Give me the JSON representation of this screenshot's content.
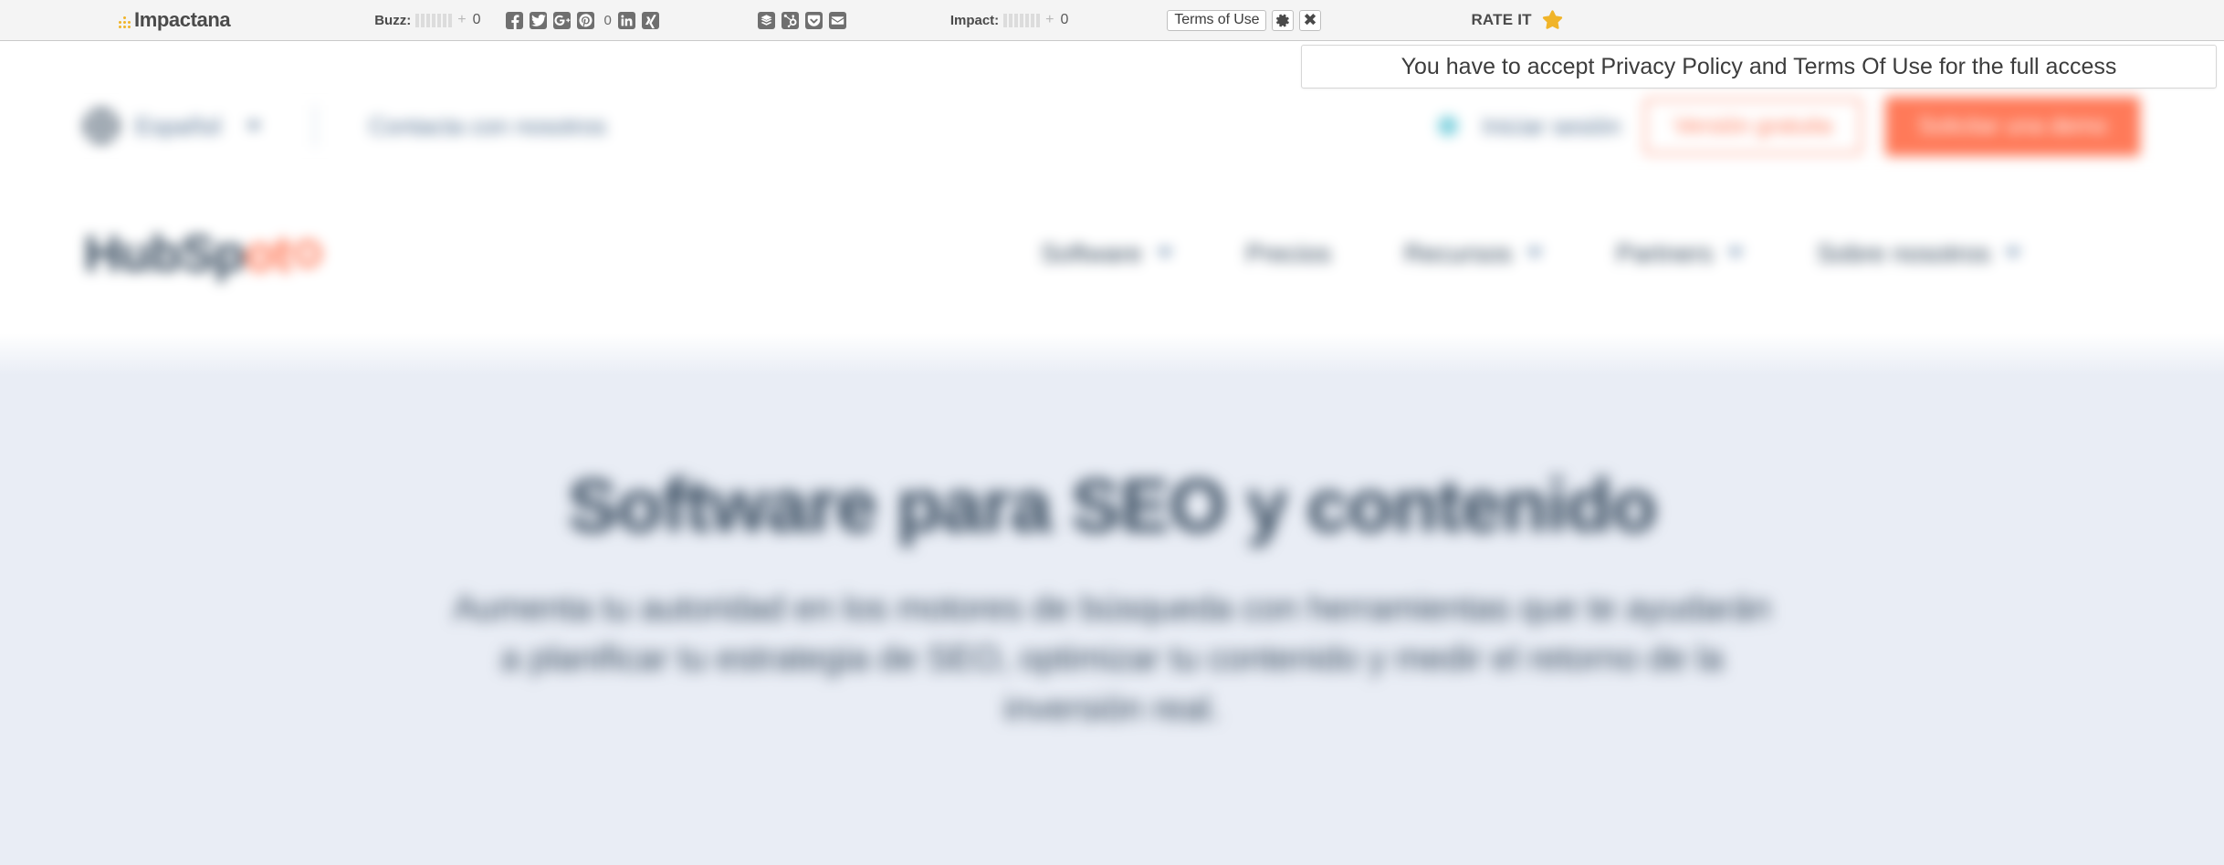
{
  "toolbar": {
    "brand": "Impactana",
    "buzz": {
      "label": "Buzz:",
      "plus": "+",
      "value": "0",
      "bars": 7
    },
    "impact": {
      "label": "Impact:",
      "plus": "+",
      "value": "0",
      "bars": 7
    },
    "share_icons": [
      {
        "name": "facebook-icon",
        "title": "Facebook",
        "count": ""
      },
      {
        "name": "twitter-icon",
        "title": "Twitter",
        "count": ""
      },
      {
        "name": "google-plus-icon",
        "title": "Google Plus",
        "count": ""
      },
      {
        "name": "pinterest-icon",
        "title": "Pinterest",
        "count": "0"
      },
      {
        "name": "linkedin-icon",
        "title": "LinkedIn",
        "count": ""
      },
      {
        "name": "xing-icon",
        "title": "XING",
        "count": ""
      }
    ],
    "content_icons": [
      {
        "name": "buffer-icon",
        "title": "Buffer"
      },
      {
        "name": "hubspot-icon",
        "title": "HubSpot"
      },
      {
        "name": "pocket-icon",
        "title": "Pocket"
      },
      {
        "name": "email-icon",
        "title": "Email"
      }
    ],
    "terms_button": "Terms of Use",
    "settings_icon": "gear-icon",
    "close_icon": "close-icon",
    "rate_it_label": "RATE IT",
    "rate_it_icon": "star-icon",
    "colors": {
      "bar_background": "#f4f4f4",
      "bar_border": "#c9c9c9",
      "brand_accent": "#f0b429",
      "icon_fill": "#6f6f6f",
      "star": "#f0b429"
    }
  },
  "banner": {
    "message": "You have to accept Privacy Policy and Terms Of Use for the full access"
  },
  "site": {
    "utility_bar": {
      "language": "Español",
      "language_icon": "globe-icon",
      "contact_link": "Contacta con nosotros",
      "right_links": [
        "Iniciar sesión"
      ],
      "secondary_button": "Versión gratuita",
      "primary_button": "Solicitar una demo"
    },
    "logo": {
      "text_dark": "HubSp",
      "text_orange": "ot"
    },
    "nav_items": [
      {
        "label": "Software",
        "has_caret": true
      },
      {
        "label": "Precios",
        "has_caret": false
      },
      {
        "label": "Recursos",
        "has_caret": true
      },
      {
        "label": "Partners",
        "has_caret": true
      },
      {
        "label": "Sobre nosotros",
        "has_caret": true
      }
    ],
    "hero": {
      "title": "Software para SEO y contenido",
      "subtitle": "Aumenta tu autoridad en los motores de búsqueda con herramientas que te ayudarán a planificar tu estrategia de SEO, optimizar tu contenido y medir el retorno de la inversión real."
    },
    "colors": {
      "brand_orange": "#ff7a59",
      "text_navy": "#33475b",
      "hero_background": "#e9edf5"
    }
  }
}
